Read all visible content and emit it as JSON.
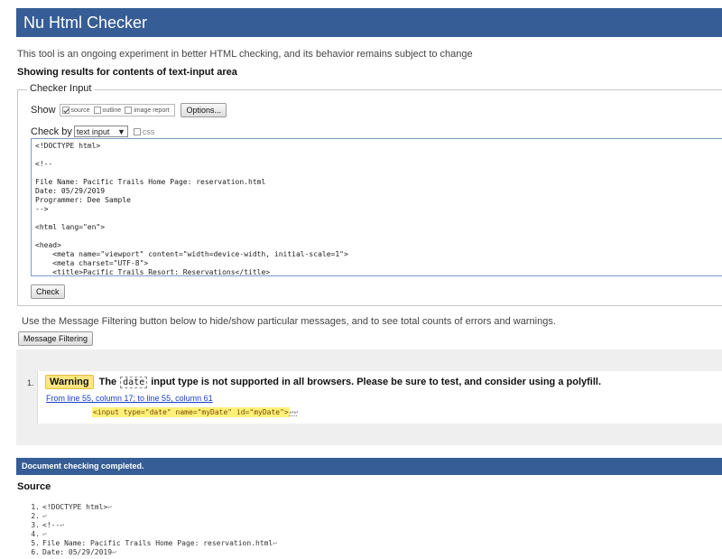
{
  "header": {
    "title": "Nu Html Checker"
  },
  "tagline": "This tool is an ongoing experiment in better HTML checking, and its behavior remains subject to change",
  "showing": "Showing results for contents of text-input area",
  "checker_input": {
    "legend": "Checker Input",
    "show_label": "Show",
    "options": [
      {
        "label": "source",
        "checked": true
      },
      {
        "label": "outline",
        "checked": false
      },
      {
        "label": "image report",
        "checked": false
      }
    ],
    "options_button": "Options...",
    "check_by_label": "Check by",
    "check_by_value": "text input",
    "css_label": "css",
    "textarea_lines": [
      "<!DOCTYPE html>",
      "",
      "<!--",
      "",
      "File Name: Pacific Trails Home Page: reservation.html",
      "Date: 05/29/2019",
      "Programmer: Dee Sample",
      "-->",
      "",
      "<html lang=\"en\">",
      "",
      "<head>",
      "    <meta name=\"viewport\" content=\"width=device-width, initial-scale=1\">",
      "    <meta charset=\"UTF-8\">",
      "    <title>Pacific Trails Resort: Reservations</title>"
    ],
    "check_button": "Check"
  },
  "filter_info": "Use the Message Filtering button below to hide/show particular messages, and to see total counts of errors and warnings.",
  "filter_button": "Message Filtering",
  "messages": [
    {
      "number": "1.",
      "type": "Warning",
      "text_before": "The",
      "code": "date",
      "text_after": "input type is not supported in all browsers. Please be sure to test, and consider using a polyfill.",
      "location": "From line 55, column 17; to line 55, column 61",
      "extract": "<input type=\"date\" name=\"myDate\" id=\"myDate\">",
      "extract_tail": "↩↩"
    }
  ],
  "completed": "Document checking completed.",
  "source_heading": "Source",
  "source_lines": [
    {
      "n": "1.",
      "text": "<!DOCTYPE html>",
      "end": "↩"
    },
    {
      "n": "2.",
      "text": "",
      "end": "↩"
    },
    {
      "n": "3.",
      "text": "<!--",
      "end": "↩"
    },
    {
      "n": "4.",
      "text": "",
      "end": "↩"
    },
    {
      "n": "5.",
      "text": "File Name: Pacific Trails Home Page: reservation.html",
      "end": "↩"
    },
    {
      "n": "6.",
      "text": "Date: 05/29/2019",
      "end": "↩"
    }
  ],
  "colors": {
    "accent": "#365d95",
    "warning": "#ffe680",
    "link": "#1a3ec8"
  }
}
